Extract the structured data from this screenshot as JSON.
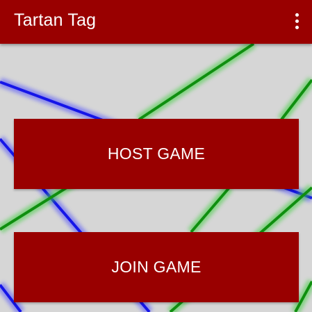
{
  "app": {
    "title": "Tartan Tag",
    "overflow_icon": "more-vert-icon"
  },
  "colors": {
    "primary": "#990000",
    "background": "#d6d6d6",
    "line_blue": "#1a1ae6",
    "line_green": "#129a12"
  },
  "actions": {
    "host_label": "HOST GAME",
    "join_label": "JOIN GAME"
  }
}
